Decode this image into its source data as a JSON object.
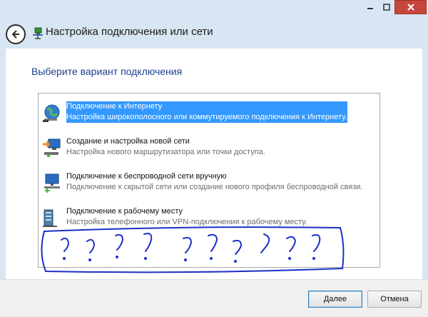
{
  "window": {
    "controls": [
      "minimize",
      "maximize",
      "close"
    ],
    "title": "Настройка подключения или сети"
  },
  "heading": "Выберите вариант подключения",
  "options": [
    {
      "title": "Подключение к Интернету",
      "desc": "Настройка широкополосного или коммутируемого подключения к Интернету.",
      "icon": "globe-network-icon",
      "selected": true
    },
    {
      "title": "Создание и настройка новой сети",
      "desc": "Настройка нового маршрутизатора или точки доступа.",
      "icon": "new-network-icon",
      "selected": false
    },
    {
      "title": "Подключение к беспроводной сети вручную",
      "desc": "Подключение к скрытой сети или создание нового профиля беспроводной связи.",
      "icon": "wireless-network-icon",
      "selected": false
    },
    {
      "title": "Подключение к рабочему месту",
      "desc": "Настройка телефонного или VPN-подключения к рабочему месту.",
      "icon": "workplace-network-icon",
      "selected": false
    }
  ],
  "annotation": {
    "text": "? ? ? ? ? ? ? ? ? ?",
    "color": "#1c2fc8"
  },
  "buttons": {
    "next": "Далее",
    "cancel": "Отмена"
  },
  "colors": {
    "selection": "#3399ff",
    "heading": "#1f3f8f",
    "close_button": "#c7463b"
  }
}
